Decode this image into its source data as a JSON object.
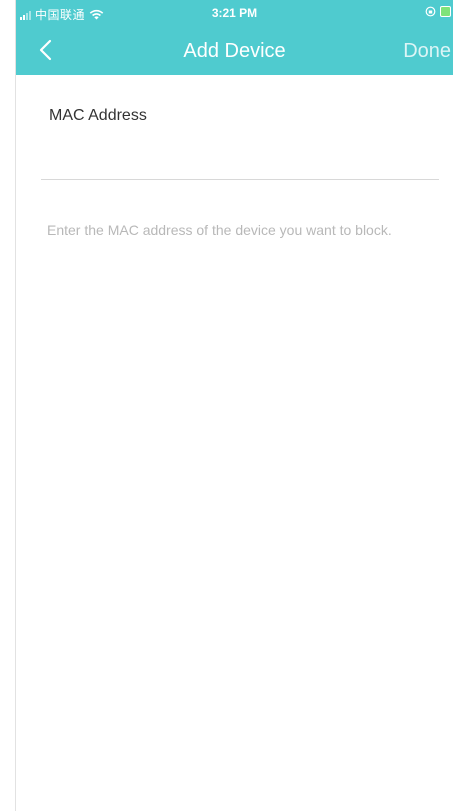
{
  "status_bar": {
    "carrier": "中国联通",
    "time": "3:21 PM",
    "signal_icon": "signal-icon",
    "wifi_icon": "wifi-icon",
    "rotation_icon": "lock-rotation-icon",
    "battery_icon": "battery-icon"
  },
  "nav": {
    "back_icon": "chevron-left-icon",
    "title": "Add Device",
    "done_label": "Done"
  },
  "form": {
    "mac_label": "MAC Address",
    "mac_value": "",
    "helper_text": "Enter the MAC address of the device you want to block."
  },
  "colors": {
    "header_bg": "#4fcbcf",
    "label_text": "#333333",
    "helper_text": "#b8b8b8",
    "underline": "#d8d8d8"
  }
}
